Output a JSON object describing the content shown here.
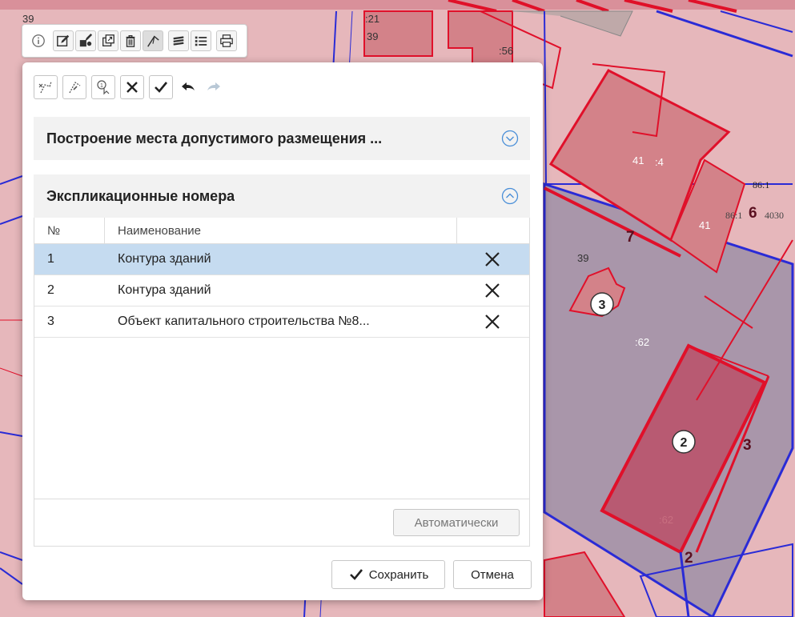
{
  "map": {
    "parcel_labels": [
      ":21",
      "39",
      ":56",
      "41",
      ":4",
      "41",
      "39",
      ":62",
      ":62",
      "86:1",
      "86:1",
      "4030",
      "39"
    ],
    "markers": [
      {
        "label": "3"
      },
      {
        "label": "2"
      }
    ],
    "edge_labels": [
      "7",
      "6",
      "3",
      "2"
    ],
    "colors": {
      "base": "#e6b7bb",
      "parcel": "#d38289",
      "selected_zone": "#a996aa",
      "outline_red": "#e0102a",
      "outline_blue": "#2a2bd6"
    }
  },
  "main_toolbar": {
    "buttons": [
      "info-icon",
      "edit-icon",
      "shape-edit-icon",
      "window-icon",
      "trash-icon",
      "measure-icon",
      "layers-icon",
      "list-icon",
      "print-icon"
    ]
  },
  "edit_tools": {
    "buttons": [
      "draw-vertex-icon",
      "draw-line-icon",
      "numbered-click-icon",
      "close-icon",
      "check-icon",
      "undo-icon",
      "redo-icon"
    ]
  },
  "section1": {
    "title": "Построение места допустимого размещения ..."
  },
  "section2": {
    "title": "Экспликационные номера",
    "columns": {
      "num": "№",
      "name": "Наименование"
    },
    "rows": [
      {
        "num": "1",
        "name": "Контура зданий"
      },
      {
        "num": "2",
        "name": "Контура зданий"
      },
      {
        "num": "3",
        "name": "Объект капитального строительства №8..."
      }
    ],
    "auto_button": "Автоматически"
  },
  "footer": {
    "save": "Сохранить",
    "cancel": "Отмена"
  }
}
